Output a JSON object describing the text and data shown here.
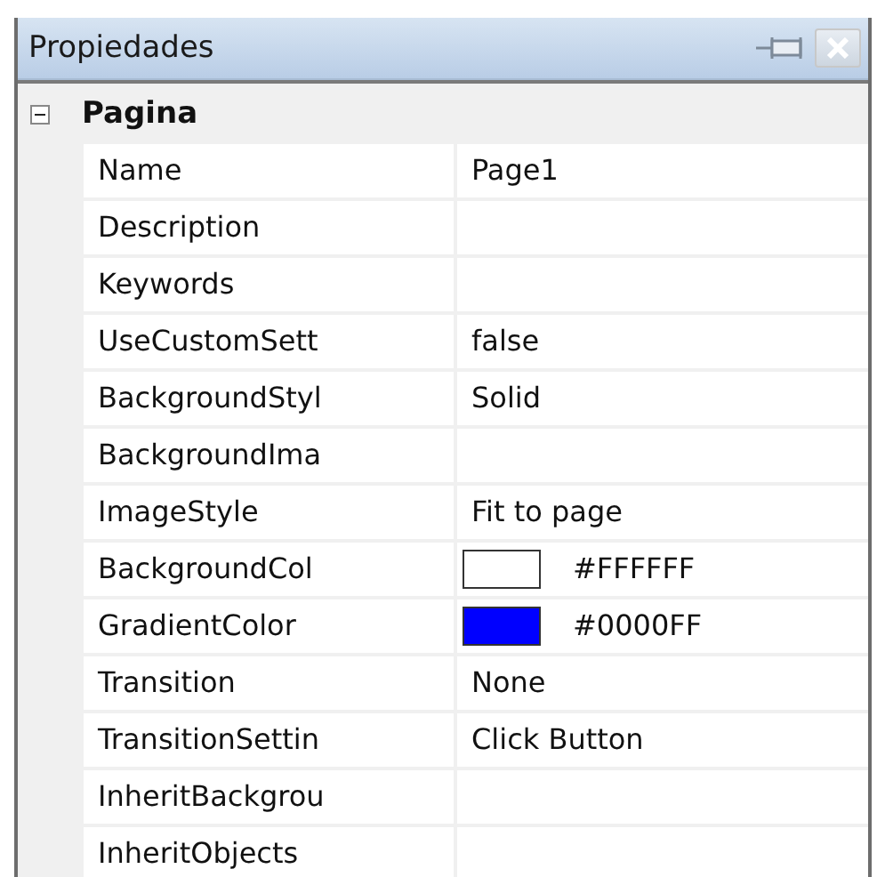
{
  "panel": {
    "title": "Propiedades"
  },
  "category": {
    "label": "Pagina",
    "expanded": true
  },
  "properties": [
    {
      "name": "Name",
      "kind": "text",
      "value": "Page1"
    },
    {
      "name": "Description",
      "kind": "text"
    },
    {
      "name": "Keywords",
      "kind": "text"
    },
    {
      "name": "UseCustomSett",
      "kind": "text",
      "value": "false"
    },
    {
      "name": "BackgroundStyl",
      "kind": "text",
      "value": "Solid"
    },
    {
      "name": "BackgroundIma",
      "kind": "text"
    },
    {
      "name": "ImageStyle",
      "kind": "text",
      "value": "Fit to page"
    },
    {
      "name": "BackgroundCol",
      "kind": "color",
      "color": "#ffffff",
      "value": "#FFFFFF"
    },
    {
      "name": "GradientColor",
      "kind": "color",
      "color": "#0000ff",
      "value": "#0000FF"
    },
    {
      "name": "Transition",
      "kind": "text",
      "value": "None"
    },
    {
      "name": "TransitionSettin",
      "kind": "text",
      "value": "Click Button"
    },
    {
      "name": "InheritBackgrou",
      "kind": "text"
    },
    {
      "name": "InheritObjects",
      "kind": "text"
    }
  ]
}
